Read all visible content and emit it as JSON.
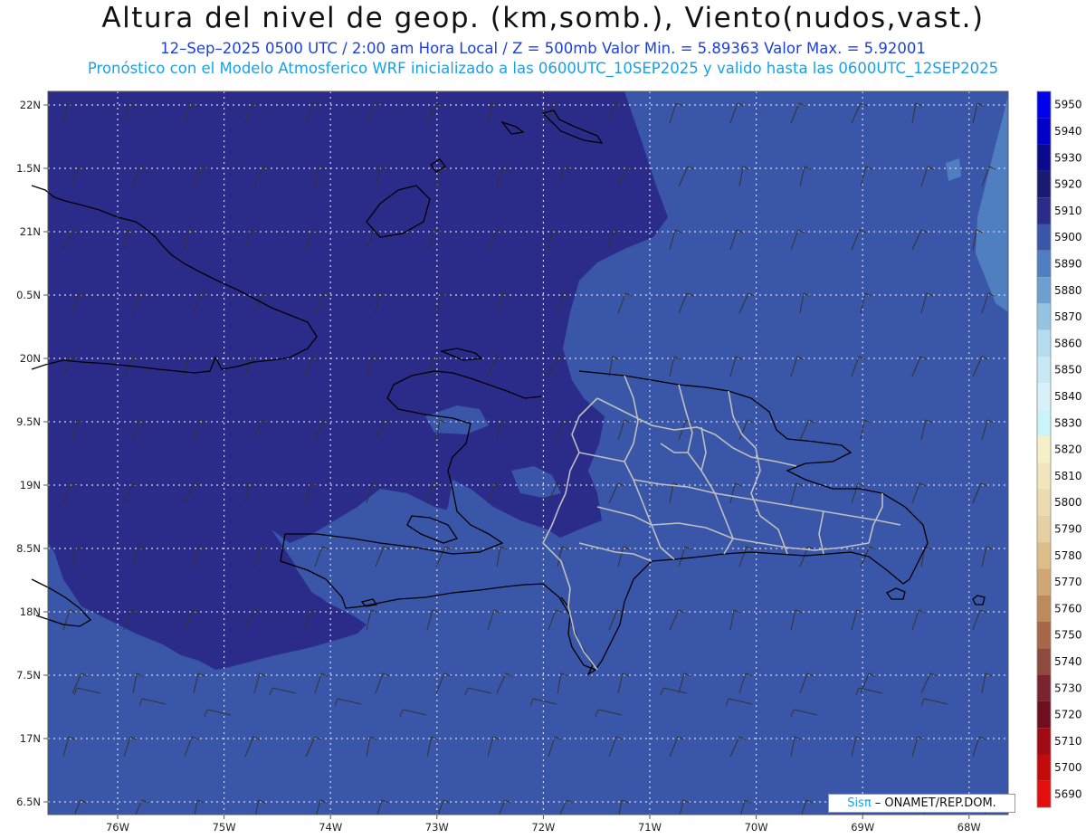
{
  "header": {
    "title": "Altura del nivel de geop. (km,somb.), Viento(nudos,vast.)",
    "subtitle_1": "12–Sep–2025  0500 UTC / 2:00 am Hora Local / Z = 500mb     Valor Min. = 5.89363  Valor Max. = 5.92001",
    "subtitle_2": "Pronóstico con el Modelo Atmosferico WRF inicializado a las 0600UTC_10SEP2025 y valido hasta las  0600UTC_12SEP2025"
  },
  "axes": {
    "lon_labels": [
      "76W",
      "75W",
      "74W",
      "73W",
      "72W",
      "71W",
      "70W",
      "69W",
      "68W"
    ],
    "lat_labels": [
      "22N",
      "1.5N",
      "21N",
      "0.5N",
      "20N",
      "9.5N",
      "19N",
      "8.5N",
      "18N",
      "7.5N",
      "17N",
      "6.5N"
    ],
    "lon_values": [
      -76,
      -75,
      -74,
      -73,
      -72,
      -71,
      -70,
      -69,
      -68
    ],
    "lat_values": [
      22,
      21.5,
      21,
      20.5,
      20,
      19.5,
      19,
      18.5,
      18,
      17.5,
      17,
      16.5
    ],
    "grid": true
  },
  "colorbar": {
    "labels": [
      "5950",
      "5940",
      "5930",
      "5920",
      "5910",
      "5900",
      "5890",
      "5880",
      "5870",
      "5860",
      "5850",
      "5840",
      "5830",
      "5820",
      "5810",
      "5800",
      "5790",
      "5780",
      "5770",
      "5760",
      "5750",
      "5740",
      "5730",
      "5720",
      "5710",
      "5700",
      "5690"
    ],
    "colors": [
      "#0000ee",
      "#0000c8",
      "#0a0a8c",
      "#1a1a70",
      "#2b2b8a",
      "#3a56a8",
      "#4f7fc0",
      "#6f9fd0",
      "#95c3e2",
      "#b5dcee",
      "#c8e9f4",
      "#d8f1f8",
      "#cbf3fa",
      "#f5f0c8",
      "#f1e6be",
      "#ecdbb0",
      "#e6cfa2",
      "#dcbd8a",
      "#cfa674",
      "#bd8a5e",
      "#a86848",
      "#8e4a3c",
      "#7a2430",
      "#6e0e1e",
      "#a00a14",
      "#c40a0a",
      "#e40e0e"
    ]
  },
  "field": {
    "colors": {
      "high": "#2b2b8a",
      "low": "#3a56a8",
      "lower": "#4f7fc0"
    }
  },
  "credit": {
    "brand": "Sisπ",
    "org": " – ONAMET/REP.DOM."
  }
}
